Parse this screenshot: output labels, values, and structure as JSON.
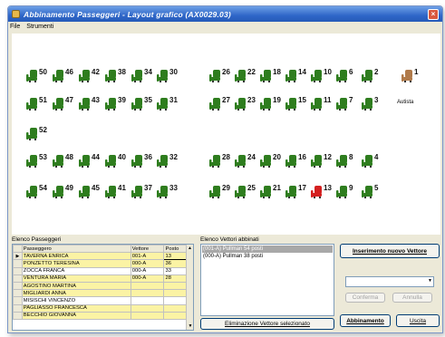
{
  "window": {
    "title": "Abbinamento Passeggeri - Layout grafico (AX0029.03)"
  },
  "menu": [
    "File",
    "Strumenti"
  ],
  "seats": {
    "row1": [
      "50",
      "46",
      "42",
      "38",
      "34",
      "30",
      "26",
      "22",
      "18",
      "14",
      "10",
      "6",
      "2"
    ],
    "row2": [
      "51",
      "47",
      "43",
      "39",
      "35",
      "31",
      "27",
      "23",
      "19",
      "15",
      "11",
      "7",
      "3"
    ],
    "row3": [
      "52"
    ],
    "row4": [
      "53",
      "48",
      "44",
      "40",
      "36",
      "32",
      "28",
      "24",
      "20",
      "16",
      "12",
      "8",
      "4"
    ],
    "row5": [
      "54",
      "49",
      "45",
      "41",
      "37",
      "33",
      "29",
      "25",
      "21",
      "17",
      "13",
      "9",
      "5"
    ],
    "driver": {
      "number": "1",
      "label": "Autista"
    },
    "selected_seat": "13"
  },
  "passengers": {
    "label": "Elenco Passeggeri",
    "columns": [
      "Passeggero",
      "Vettore",
      "Posto"
    ],
    "rows": [
      {
        "name": "TAVERNA ENRICA",
        "vettore": "001-A",
        "posto": "13",
        "highlight": true,
        "current": true
      },
      {
        "name": "PONZETTO TERESINA",
        "vettore": "000-A",
        "posto": "36",
        "highlight": true
      },
      {
        "name": "ZOCCA FRANCA",
        "vettore": "000-A",
        "posto": "33",
        "highlight": false
      },
      {
        "name": "VENTURA MARIA",
        "vettore": "000-A",
        "posto": "28",
        "highlight": true
      },
      {
        "name": "AGOSTINO MARTINA",
        "vettore": "",
        "posto": "",
        "highlight": true
      },
      {
        "name": "MIGLIARDI ANNA",
        "vettore": "",
        "posto": "",
        "highlight": true
      },
      {
        "name": "MISISCHI VINCENZO",
        "vettore": "",
        "posto": "",
        "highlight": false
      },
      {
        "name": "PAGLIASSO FRANCESCA",
        "vettore": "",
        "posto": "",
        "highlight": true
      },
      {
        "name": "BECCHIO GIOVANNA",
        "vettore": "",
        "posto": "",
        "highlight": true
      }
    ]
  },
  "vettori": {
    "label": "Elenco Vettori abbinati",
    "items": [
      "(001-A) Pullman 54 posti",
      "(000-A) Pullman 38 posti"
    ],
    "remove_button": "Eliminazione Vettore selezionato"
  },
  "actions": {
    "new_vehicle": "Inserimento nuovo Vettore",
    "confirm": "Conferma",
    "cancel": "Annulla",
    "match": "Abbinamento",
    "exit": "Uscita"
  },
  "colors": {
    "seat": "#2e7d1e",
    "seat_selected": "#d42020",
    "titlebar": "#2f67c8",
    "highlight_row": "#fbf3a4"
  }
}
